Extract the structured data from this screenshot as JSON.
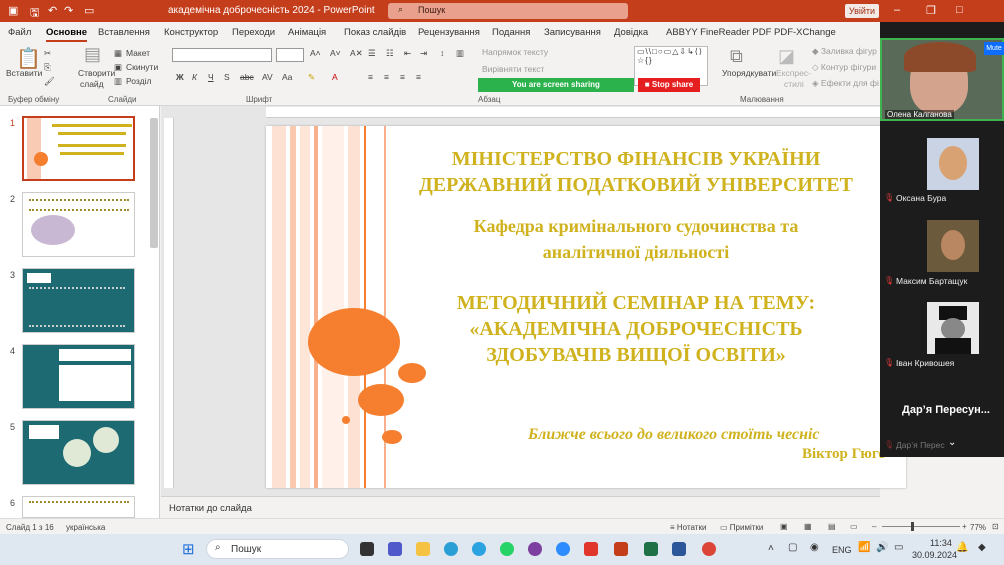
{
  "titlebar": {
    "doc_title": "академічна доброчесність 2024",
    "separator": "-",
    "app_name": "PowerPoint",
    "search_placeholder": "Пошук",
    "signin": "Увійти"
  },
  "tabs": [
    "Файл",
    "Основне",
    "Вставлення",
    "Конструктор",
    "Переходи",
    "Анімація",
    "Показ слайдів",
    "Рецензування",
    "Подання",
    "Записування",
    "Довідка",
    "ABBYY FineReader PDF",
    "PDF-XChange"
  ],
  "ribbon": {
    "paste": "Вставити",
    "new_slide_line1": "Створити",
    "new_slide_line2": "слайд",
    "layout": "Макет",
    "reset": "Скинути",
    "section": "Розділ",
    "text_direction": "Напрямок тексту",
    "align_text": "Вирівняти текст",
    "arrange": "Упорядкувати",
    "quick_styles_line1": "Експрес-",
    "quick_styles_line2": "стилі",
    "shape_fill": "Заливка фігур",
    "shape_outline": "Контур фігури",
    "shape_effects": "Ефекти для фі",
    "groups": [
      "Буфер обміну",
      "Слайди",
      "Шрифт",
      "Абзац",
      "Малювання"
    ]
  },
  "screen_share": {
    "status": "You are screen sharing",
    "stop": "Stop share"
  },
  "thumbnails": [
    "1",
    "2",
    "3",
    "4",
    "5",
    "6"
  ],
  "slide": {
    "line1": "МІНІСТЕРСТВО ФІНАНСІВ УКРАЇНИ",
    "line2": "ДЕРЖАВНИЙ ПОДАТКОВИЙ УНІВЕРСИТЕТ",
    "dept1": "Кафедра кримінального судочинства та",
    "dept2": "аналітичної діяльності",
    "seminar1": "МЕТОДИЧНИЙ СЕМІНАР НА ТЕМУ:",
    "seminar2": "«АКАДЕМІЧНА ДОБРОЧЕСНІСТЬ",
    "seminar3": "ЗДОБУВАЧІВ ВИЩОЇ ОСВІТИ»",
    "quote": "Ближче всього до великого стоїть чесніс",
    "author": "Віктор Гюго"
  },
  "notes_placeholder": "Нотатки до слайда",
  "participants": {
    "mute": "Mute",
    "p1": "Олена Калганова",
    "p2": "Оксана Бура",
    "p3": "Максим Бартащук",
    "p4": "Іван Кривошея",
    "speaker": "Дар’я Пересун...",
    "speaker_faded": "Дар’я Перес"
  },
  "statusbar": {
    "slide_info": "Слайд 1 з 16",
    "language": "українська",
    "notes": "Нотатки",
    "comments": "Примітки",
    "zoom": "77%"
  },
  "taskbar": {
    "search": "Пошук",
    "lang": "ENG",
    "time": "11:34",
    "date": "30.09.2024"
  },
  "colors": {
    "accent": "#c43e1c",
    "slide_title": "#cfb21d",
    "circles": "#f57f2f",
    "share_green": "#2bb24c",
    "share_red": "#e51f1f"
  }
}
